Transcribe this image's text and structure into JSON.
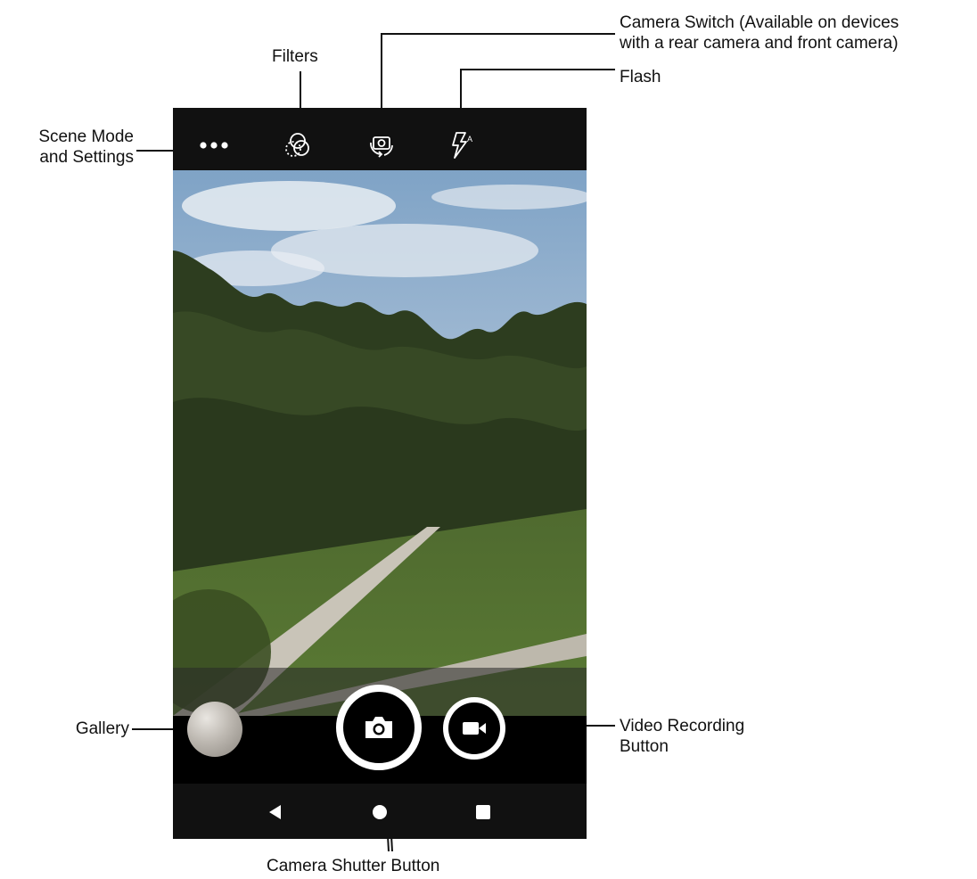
{
  "callouts": {
    "camera_switch": {
      "line1": "Camera Switch (Available on devices",
      "line2": "with a rear camera and front camera)"
    },
    "flash": "Flash",
    "filters": "Filters",
    "scene_mode": {
      "line1": "Scene Mode",
      "line2": "and Settings"
    },
    "gallery": "Gallery",
    "video_recording": {
      "line1": "Video Recording",
      "line2": "Button"
    },
    "camera_shutter": "Camera Shutter Button"
  },
  "topbar": {
    "icons": [
      "more-options-icon",
      "filters-icon",
      "camera-switch-icon",
      "flash-auto-icon"
    ]
  },
  "controls": {
    "shutter_icon": "camera-icon",
    "video_icon": "video-camera-icon"
  },
  "navbar": {
    "icons": [
      "back-triangle-icon",
      "home-circle-icon",
      "recents-square-icon"
    ]
  },
  "colors": {
    "bar_dark": "#111111",
    "controls_black": "#000000",
    "ring_white": "#ffffff"
  }
}
